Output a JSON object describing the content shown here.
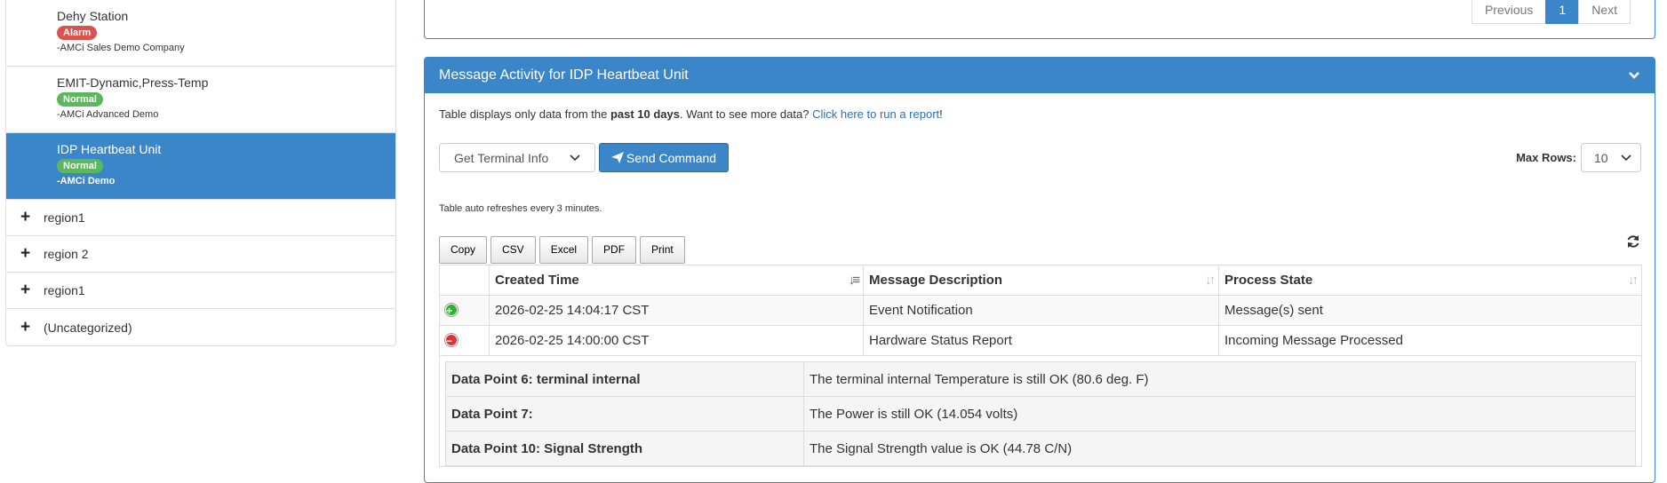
{
  "sidebar": {
    "devices": [
      {
        "name": "Dehy Station",
        "status": "Alarm",
        "company": "-AMCi Sales Demo Company"
      },
      {
        "name": "EMIT-Dynamic,Press-Temp",
        "status": "Normal",
        "company": "-AMCi Advanced Demo"
      },
      {
        "name": "IDP Heartbeat Unit",
        "status": "Normal",
        "company": "-AMCi Demo"
      }
    ],
    "regions": [
      "region1",
      "region 2",
      "region1",
      "(Uncategorized)"
    ]
  },
  "pager": {
    "previous": "Previous",
    "current": "1",
    "next": "Next"
  },
  "panel": {
    "title": "Message Activity for IDP Heartbeat Unit",
    "note_prefix": "Table displays only data from the ",
    "note_bold": "past 10 days",
    "note_mid": ". Want to see more data? ",
    "note_link": "Click here to run a report",
    "note_suffix": "!",
    "command_select": "Get Terminal Info",
    "send_label": "Send Command",
    "max_rows_label": "Max Rows:",
    "max_rows_value": "10",
    "refresh_note": "Table auto refreshes every 3 minutes.",
    "export_buttons": [
      "Copy",
      "CSV",
      "Excel",
      "PDF",
      "Print"
    ]
  },
  "table": {
    "headers": [
      "Created Time",
      "Message Description",
      "Process State"
    ],
    "rows": [
      {
        "time": "2026-02-25 14:04:17 CST",
        "desc": "Event Notification",
        "state": "Message(s) sent"
      },
      {
        "time": "2026-02-25 14:00:00 CST",
        "desc": "Hardware Status Report",
        "state": "Incoming Message Processed"
      }
    ],
    "details": [
      {
        "key": "Data Point 6: terminal internal",
        "value": "The terminal internal Temperature is still OK (80.6 deg. F)"
      },
      {
        "key": "Data Point 7:",
        "value": "The Power is still OK (14.054 volts)"
      },
      {
        "key": "Data Point 10: Signal Strength",
        "value": "The Signal Strength value is OK (44.78 C/N)"
      }
    ]
  },
  "colors": {
    "primary": "#3a86c8",
    "alarm": "#d9534f",
    "normal": "#5cb85c"
  }
}
